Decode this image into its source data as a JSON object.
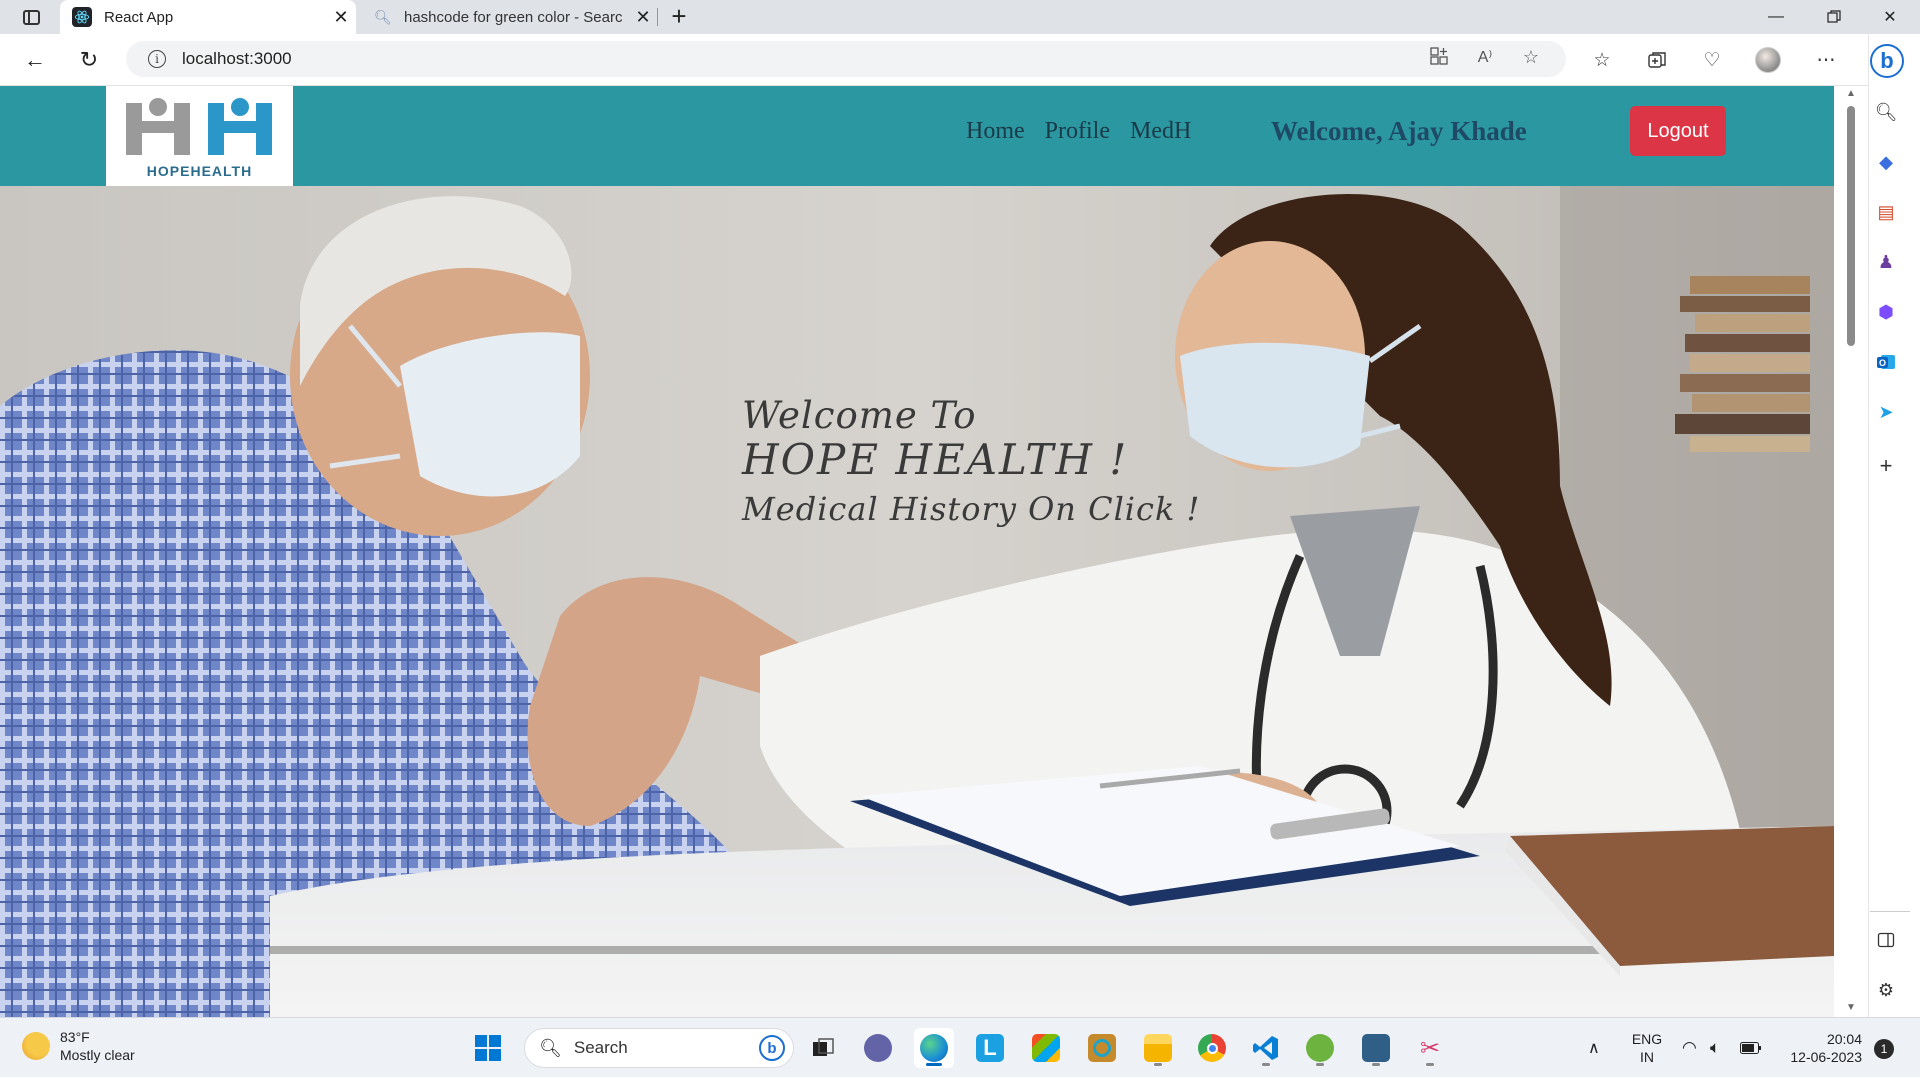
{
  "browser": {
    "tabs": [
      {
        "title": "React App",
        "active": true
      },
      {
        "title": "hashcode for green color - Searc",
        "active": false
      }
    ],
    "address": "localhost:3000",
    "accent": "#1b6fd1"
  },
  "app": {
    "logo_text": "HOPEHEALTH",
    "nav": [
      {
        "label": "Home"
      },
      {
        "label": "Profile"
      },
      {
        "label": "MedH"
      }
    ],
    "welcome": "Welcome, Ajay Khade",
    "logout_label": "Logout",
    "header_color": "#2b97a1",
    "logout_color": "#dc3545"
  },
  "hero": {
    "line1": "Welcome To",
    "line2": "HOPE HEALTH  !",
    "line3": "Medical History On Click !"
  },
  "taskbar": {
    "weather_temp": "83°F",
    "weather_desc": "Mostly clear",
    "search_label": "Search",
    "lang_line1": "ENG",
    "lang_line2": "IN",
    "time": "20:04",
    "date": "12-06-2023",
    "notification_count": "1"
  }
}
